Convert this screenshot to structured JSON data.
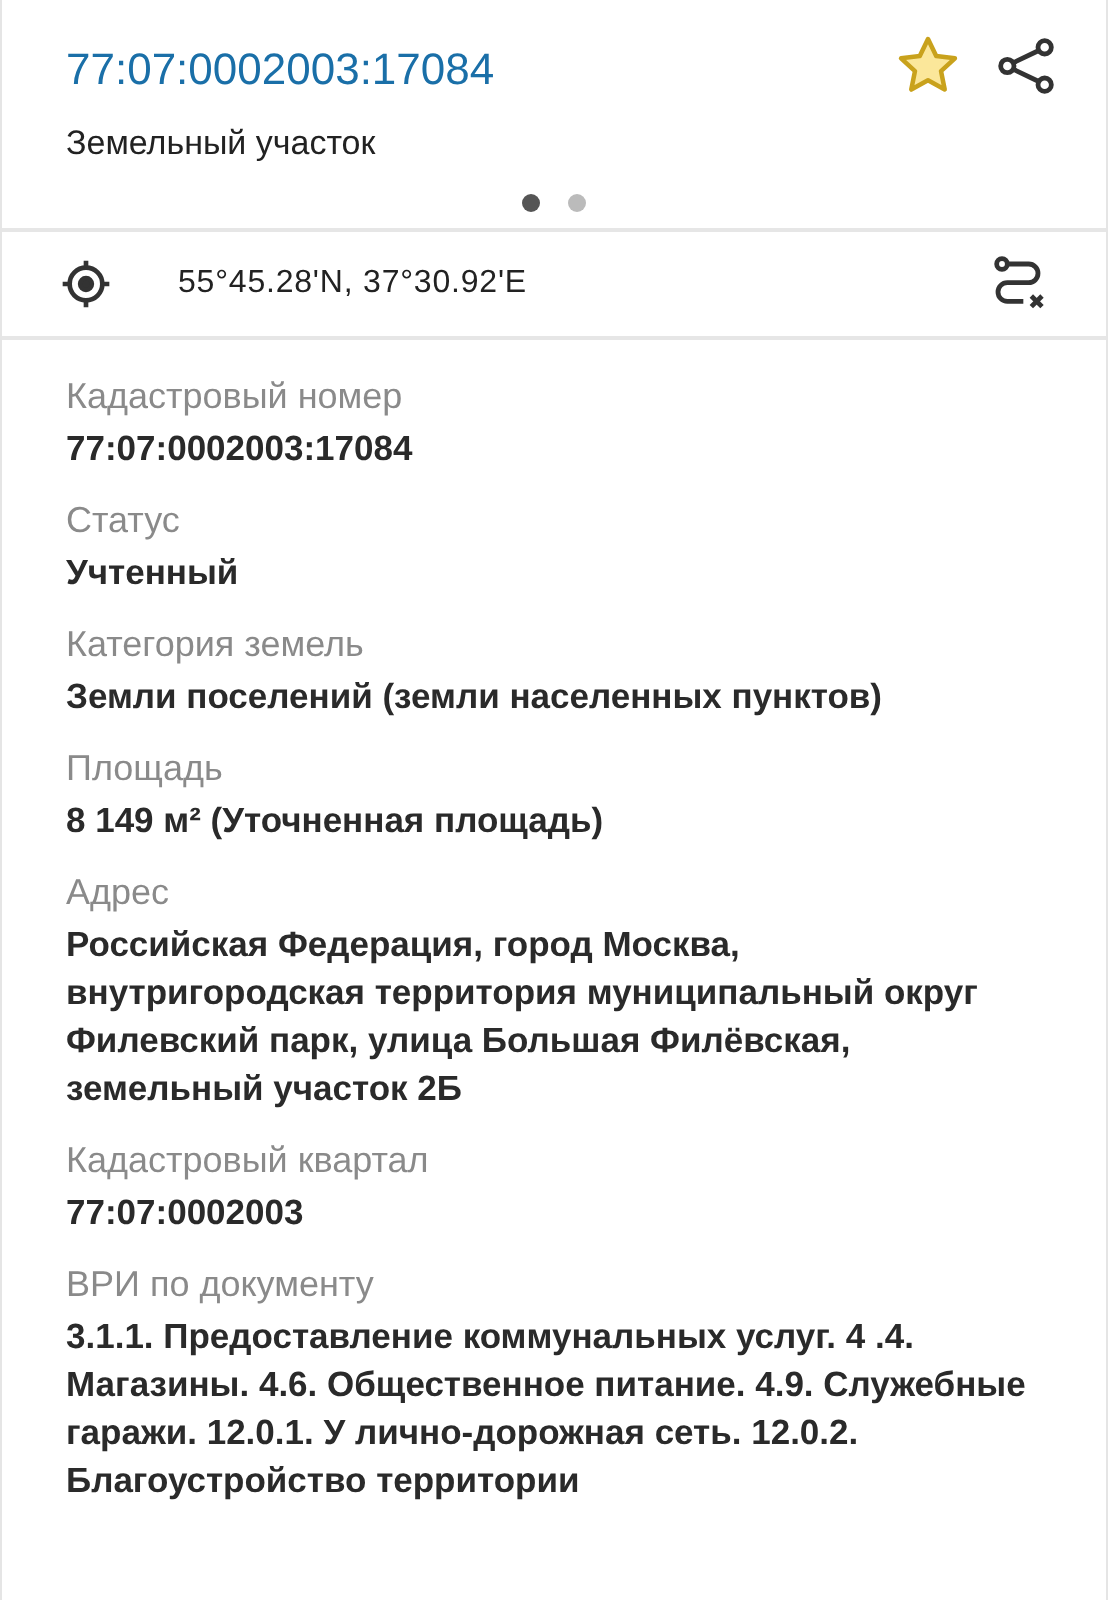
{
  "header": {
    "title": "77:07:0002003:17084",
    "subtitle": "Земельный участок",
    "starred": true,
    "pages": [
      {
        "selected": true
      },
      {
        "selected": false
      }
    ]
  },
  "location": {
    "coordinates": "55°45.28'N, 37°30.92'E"
  },
  "fields": [
    {
      "label": "Кадастровый номер",
      "value": "77:07:0002003:17084"
    },
    {
      "label": "Статус",
      "value": "Учтенный"
    },
    {
      "label": "Категория земель",
      "value": "Земли поселений (земли населенных пунктов)"
    },
    {
      "label": "Площадь",
      "value": "8 149 м² (Уточненная площадь)"
    },
    {
      "label": "Адрес",
      "value": "Российская Федерация, город Москва, внутригородская территория муниципальный округ Филевский парк, улица Большая Филёвская, земельный участок 2Б"
    },
    {
      "label": "Кадастровый квартал",
      "value": "77:07:0002003"
    },
    {
      "label": "ВРИ по документу",
      "value": "3.1.1. Предоставление коммунальных услуг. 4 .4. Магазины. 4.6. Общественное питание. 4.9. Служебные гаражи. 12.0.1. У лично-дорожная сеть. 12.0.2. Благоустройство территории"
    }
  ]
}
